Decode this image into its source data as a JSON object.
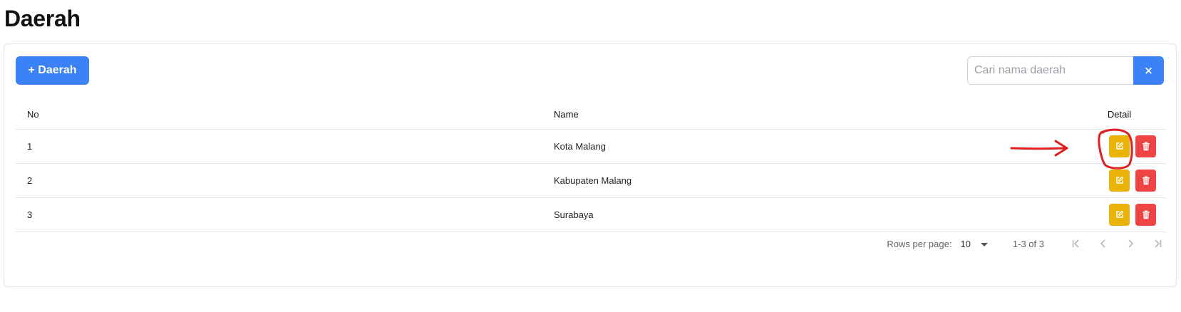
{
  "page": {
    "title": "Daerah"
  },
  "toolbar": {
    "add_label": "+ Daerah",
    "search_placeholder": "Cari nama daerah",
    "search_value": "",
    "clear_label": "×"
  },
  "table": {
    "headers": {
      "no": "No",
      "name": "Name",
      "detail": "Detail"
    },
    "rows": [
      {
        "no": "1",
        "name": "Kota Malang"
      },
      {
        "no": "2",
        "name": "Kabupaten Malang"
      },
      {
        "no": "3",
        "name": "Surabaya"
      }
    ]
  },
  "pagination": {
    "rows_per_page_label": "Rows per page:",
    "rows_per_page_value": "10",
    "range_text": "1-3 of 3"
  },
  "icons": {
    "edit": "edit-icon",
    "delete": "trash-icon",
    "first": "first-page-icon",
    "prev": "chevron-left-icon",
    "next": "chevron-right-icon",
    "last": "last-page-icon"
  },
  "colors": {
    "primary": "#3b82f6",
    "edit": "#eab308",
    "delete": "#ef4444",
    "annotation": "#e02020"
  }
}
